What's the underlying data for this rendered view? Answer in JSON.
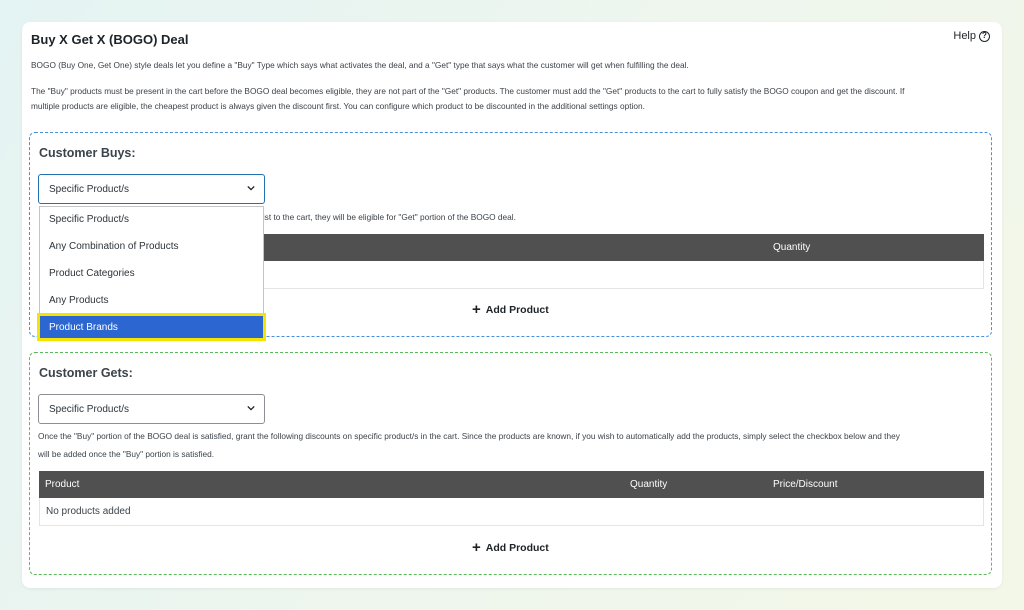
{
  "header": {
    "title": "Buy X Get X (BOGO) Deal",
    "help_label": "Help",
    "help_icon": "?"
  },
  "description": {
    "line1": "BOGO (Buy One, Get One) style deals let you define a \"Buy\" Type which says what activates the deal, and a \"Get\" type that says what the customer will get when fulfilling the deal.",
    "line2": "The \"Buy\" products must be present in the cart before the BOGO deal becomes eligible, they are not part of the \"Get\" products. The customer must add the \"Get\" products to the cart to fully satisfy the BOGO coupon and get the discount. If",
    "line3": "multiple products are eligible, the cheapest product is always given the discount first. You can configure which product to be discounted in the additional settings option."
  },
  "customer_buys": {
    "title": "Customer Buys:",
    "select_value": "Specific Product/s",
    "info_text": "list to the cart, they will be eligible for \"Get\" portion of the BOGO deal.",
    "columns": [
      "Quantity"
    ],
    "add_label": "Add Product",
    "dropdown_options": [
      "Specific Product/s",
      "Any Combination of Products",
      "Product Categories",
      "Any Products",
      "Product Brands"
    ],
    "highlighted_option": "Product Brands"
  },
  "customer_gets": {
    "title": "Customer Gets:",
    "select_value": "Specific Product/s",
    "info_line1": "Once the \"Buy\" portion of the BOGO deal is satisfied, grant the following discounts on specific product/s in the cart. Since the products are known, if you wish to automatically add the products, simply select the checkbox below and they",
    "info_line2": "will be added once the \"Buy\" portion is satisfied.",
    "columns": [
      "Product",
      "Quantity",
      "Price/Discount"
    ],
    "empty_text": "No products added",
    "add_label": "Add Product"
  },
  "colors": {
    "buys_border": "#4a90d9",
    "gets_border": "#5cb85c",
    "table_header": "#505050",
    "highlight_bg": "#2b66d1",
    "highlight_outline": "#f5e400"
  }
}
